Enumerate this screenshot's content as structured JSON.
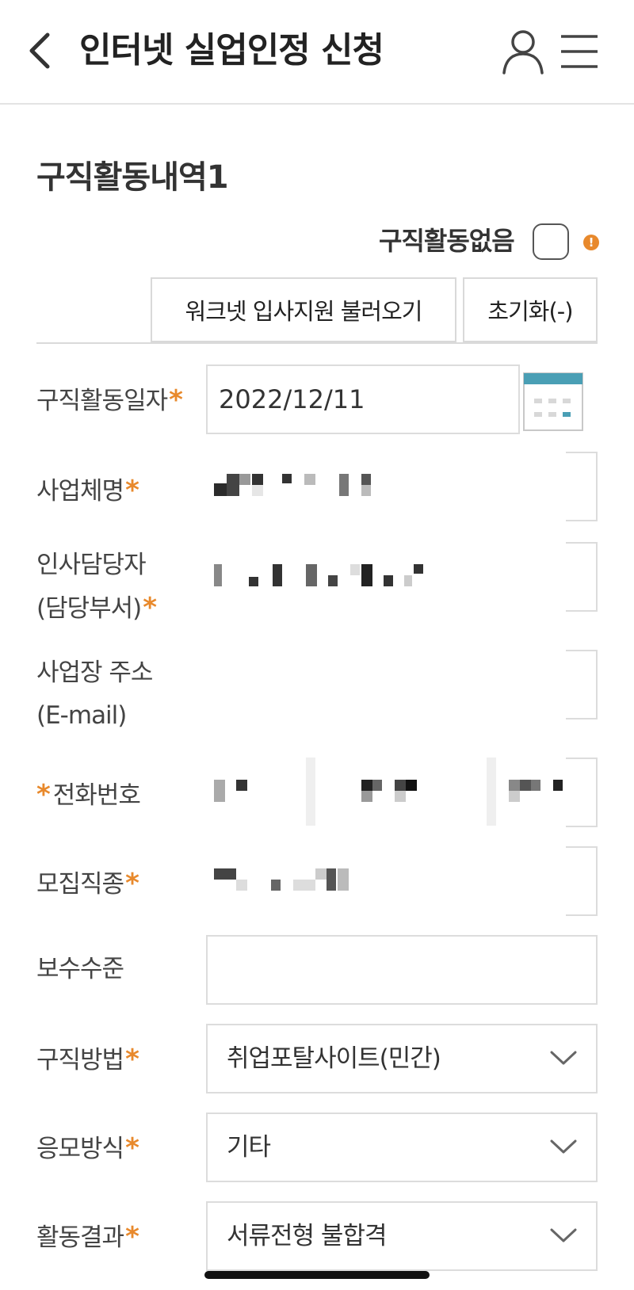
{
  "header": {
    "title": "인터넷 실업인정 신청",
    "back_icon": "chevron-left-icon",
    "user_icon": "user-icon",
    "menu_icon": "hamburger-menu-icon"
  },
  "section": {
    "title": "구직활동내역1",
    "no_activity_label": "구직활동없음",
    "no_activity_checked": false,
    "info_icon_glyph": "!"
  },
  "buttons": {
    "load_worknet": "워크넷 입사지원 불러오기",
    "reset": "초기화(-)"
  },
  "form": {
    "required_mark": "*",
    "activity_date": {
      "label": "구직활동일자",
      "value": "2022/12/11"
    },
    "company_name": {
      "label": "사업체명"
    },
    "hr_contact": {
      "label_line1": "인사담당자",
      "label_line2": "(담당부서)"
    },
    "address": {
      "label_line1": "사업장 주소",
      "label_line2": "(E-mail)"
    },
    "phone": {
      "label": "전화번호"
    },
    "job_type": {
      "label": "모집직종"
    },
    "salary": {
      "label": "보수수준",
      "value": ""
    },
    "method": {
      "label": "구직방법",
      "value": "취업포탈사이트(민간)"
    },
    "apply_type": {
      "label": "응모방식",
      "value": "기타"
    },
    "result": {
      "label": "활동결과",
      "value": "서류전형 불합격"
    }
  },
  "colors": {
    "accent": "#e8892c",
    "calendar_teal": "#4a9fb5",
    "border": "#dcdcdc"
  }
}
